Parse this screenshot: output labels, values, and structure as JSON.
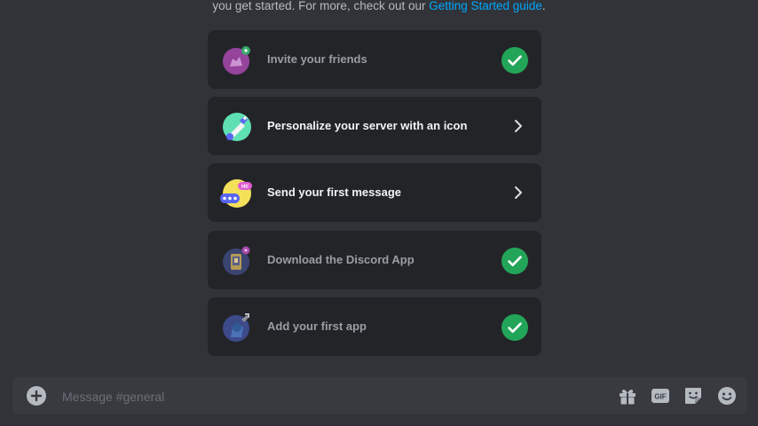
{
  "intro": {
    "text": "you get started. For more, check out our ",
    "link": "Getting Started guide",
    "suffix": "."
  },
  "checklist": [
    {
      "label": "Invite your friends",
      "status": "done",
      "icon": "invite-friends-icon"
    },
    {
      "label": "Personalize your server with an icon",
      "status": "todo",
      "icon": "personalize-icon"
    },
    {
      "label": "Send your first message",
      "status": "todo",
      "icon": "message-bubble-icon"
    },
    {
      "label": "Download the Discord App",
      "status": "done",
      "icon": "download-app-icon"
    },
    {
      "label": "Add your first app",
      "status": "done",
      "icon": "add-app-icon"
    }
  ],
  "composer": {
    "placeholder": "Message #general",
    "tools": [
      "gift-icon",
      "gif-icon",
      "sticker-icon",
      "emoji-icon"
    ]
  },
  "colors": {
    "background": "#323339",
    "card": "#232428",
    "check": "#23a559",
    "link": "#00a8fc"
  }
}
